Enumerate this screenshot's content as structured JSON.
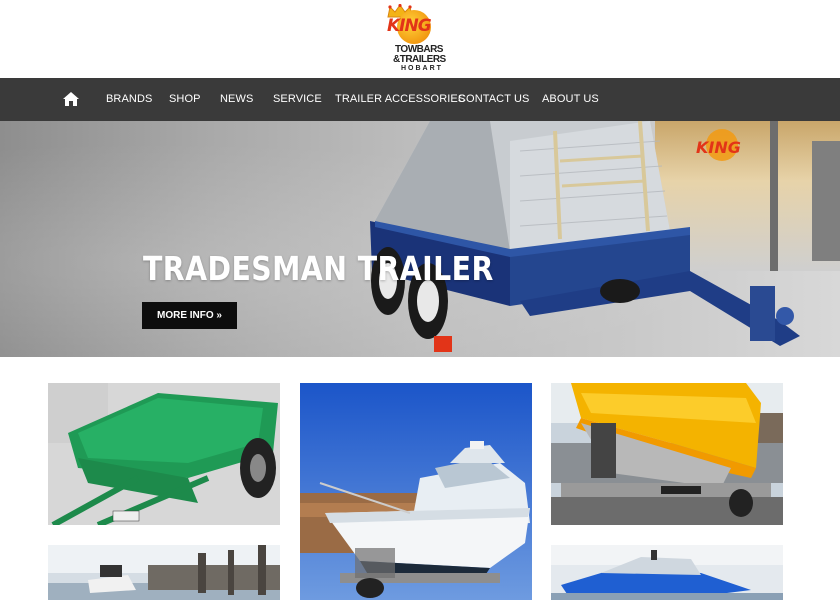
{
  "logo": {
    "line1": "KING",
    "line2": "TOWBARS",
    "line3": "&TRAILERS",
    "line4": "HOBART"
  },
  "nav": {
    "home_icon": "home-icon",
    "items": [
      {
        "label": "BRANDS"
      },
      {
        "label": "SHOP"
      },
      {
        "label": "NEWS"
      },
      {
        "label": "SERVICE"
      },
      {
        "label": "TRAILER ACCESSORIES"
      },
      {
        "label": "CONTACT US"
      },
      {
        "label": "ABOUT US"
      }
    ]
  },
  "hero": {
    "title": "TRADESMAN TRAILER",
    "button_label": "MORE INFO »",
    "sign_text": "KING"
  },
  "colors": {
    "nav_bg": "#3a3a3a",
    "button_bg": "#0d0d0d",
    "trailer_blue": "#1f3d86",
    "brand_orange": "#f29a12",
    "brand_red": "#e23418"
  },
  "thumbnails": [
    {
      "subject": "green-trailer-image"
    },
    {
      "subject": "white-boat-on-trailer-image"
    },
    {
      "subject": "yellow-boat-on-trailer-image"
    },
    {
      "subject": "jetty-boats-image"
    },
    {
      "subject": "cloudy-sky-image"
    },
    {
      "subject": "blue-boat-image"
    }
  ]
}
